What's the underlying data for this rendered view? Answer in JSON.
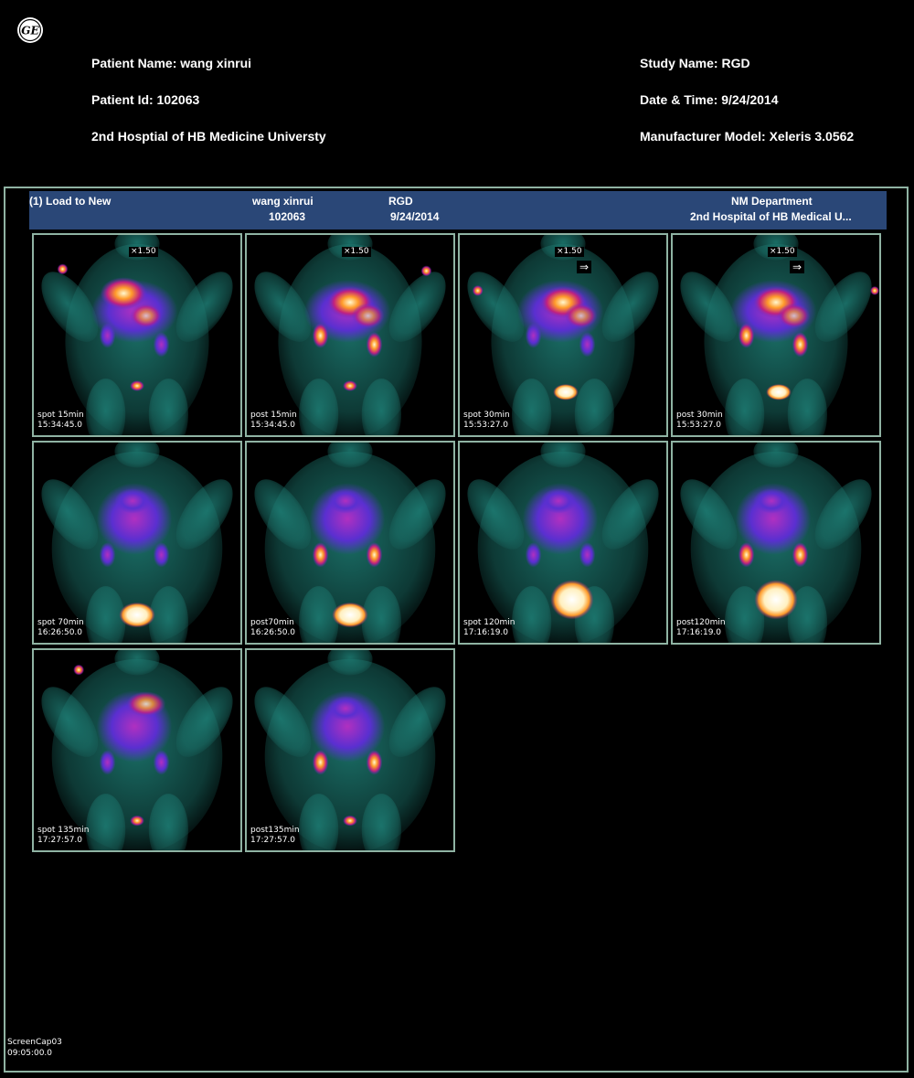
{
  "header": {
    "patient_name": "Patient Name: wang xinrui",
    "patient_id": "Patient Id: 102063",
    "hospital": "2nd Hosptial of HB Medicine Universty",
    "study_name": "Study Name: RGD",
    "date_time": "Date & Time: 9/24/2014",
    "manufacturer": "Manufacturer Model: Xeleris 3.0562"
  },
  "bar": {
    "load": "(1) Load to New",
    "patient": "wang xinrui",
    "patient_id": "102063",
    "study": "RGD",
    "date": "9/24/2014",
    "dept": "NM Department",
    "hospital": "2nd Hospital of HB Medical U..."
  },
  "panels": [
    {
      "label": "spot 15min",
      "time": "15:34:45.0",
      "zoom": "×1.50",
      "arrow": ""
    },
    {
      "label": "post 15min",
      "time": "15:34:45.0",
      "zoom": "×1.50",
      "arrow": ""
    },
    {
      "label": "spot 30min",
      "time": "15:53:27.0",
      "zoom": "×1.50",
      "arrow": "⇒"
    },
    {
      "label": "post 30min",
      "time": "15:53:27.0",
      "zoom": "×1.50",
      "arrow": "⇒"
    },
    {
      "label": "spot 70min",
      "time": "16:26:50.0",
      "zoom": "",
      "arrow": ""
    },
    {
      "label": "post70min",
      "time": "16:26:50.0",
      "zoom": "",
      "arrow": ""
    },
    {
      "label": "spot 120min",
      "time": "17:16:19.0",
      "zoom": "",
      "arrow": ""
    },
    {
      "label": "post120min",
      "time": "17:16:19.0",
      "zoom": "",
      "arrow": ""
    },
    {
      "label": "spot 135min",
      "time": "17:27:57.0",
      "zoom": "",
      "arrow": ""
    },
    {
      "label": "post135min",
      "time": "17:27:57.0",
      "zoom": "",
      "arrow": ""
    }
  ],
  "footer": {
    "capture": "ScreenCap03",
    "time": "09:05:00.0"
  },
  "colors": {
    "frame_border": "#8fb3a3",
    "bar_bg": "#2a4777",
    "scan_body": "#1e7f76",
    "scan_mid": "#5a2fd0",
    "scan_hot": "#ff9b2a"
  }
}
